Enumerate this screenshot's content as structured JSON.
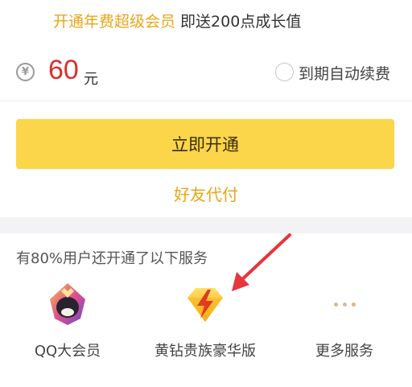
{
  "promo": {
    "highlight": "开通年费超级会员",
    "rest": " 即送200点成长值"
  },
  "price": {
    "currency_icon": "¥",
    "amount": "60",
    "unit": "元",
    "auto_renew_label": "到期自动续费"
  },
  "actions": {
    "open_label": "立即开通",
    "friend_pay_label": "好友代付"
  },
  "services": {
    "title": "有80%用户还开通了以下服务",
    "items": [
      {
        "label": "QQ大会员",
        "icon": "qq-big-member-icon"
      },
      {
        "label": "黄钻贵族豪华版",
        "icon": "yellow-diamond-icon"
      },
      {
        "label": "更多服务",
        "icon": "more-dots-icon"
      }
    ]
  },
  "colors": {
    "accent": "#fbd54a",
    "highlight_text": "#e9a617",
    "price": "#d8302a",
    "arrow": "#e8343c"
  }
}
